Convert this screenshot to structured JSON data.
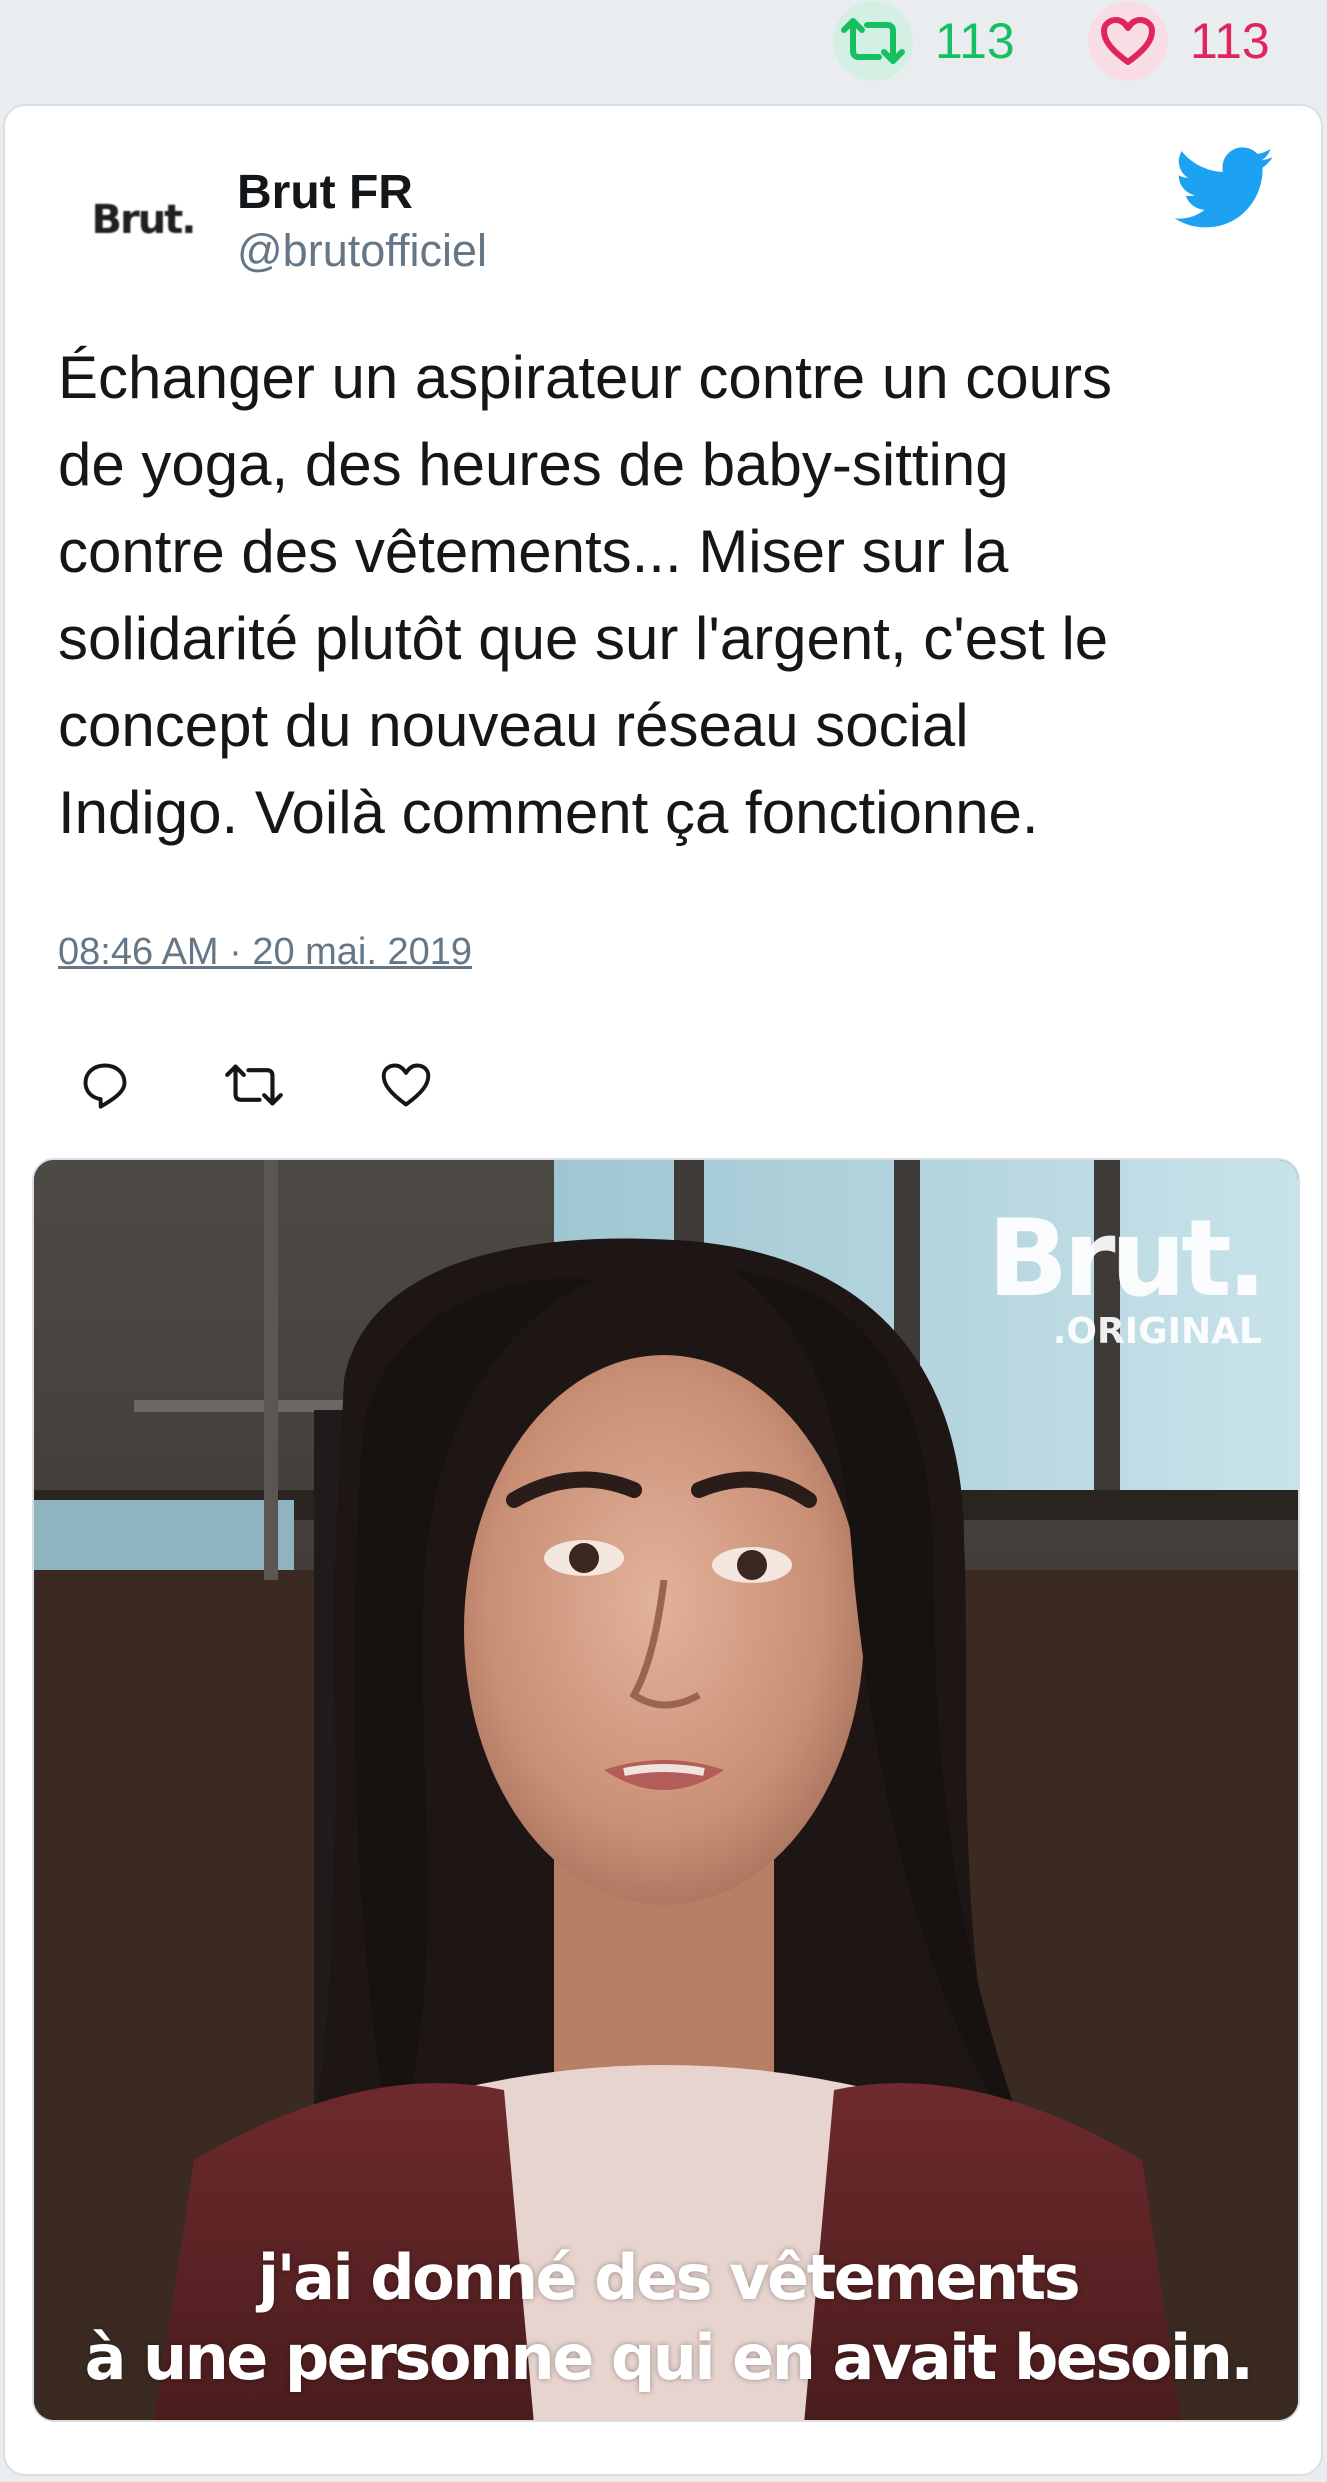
{
  "stats": {
    "retweet_icon": "retweet-icon",
    "retweet_count": "113",
    "like_icon": "heart-icon",
    "like_count": "113"
  },
  "tweet": {
    "avatar_text": "Brut.",
    "user_name": "Brut FR",
    "user_handle": "@brutofficiel",
    "text": "Échanger un aspirateur contre un cours\nde yoga, des heures de baby-sitting\ncontre des vêtements... Miser sur la\nsolidarité plutôt que sur l'argent, c'est le\nconcept du nouveau réseau social\nIndigo. Voilà comment ça fonctionne.",
    "timestamp": "08:46 AM · 20 mai. 2019",
    "actions": [
      "reply-icon",
      "retweet-icon",
      "heart-icon"
    ]
  },
  "media": {
    "watermark_logo": "Brut.",
    "watermark_sub": ".ORIGINAL",
    "subtitle": "j'ai donné des vêtements\nà une personne qui en avait besoin."
  },
  "colors": {
    "background": "#e9edf0",
    "retweet_green": "#17bf63",
    "like_red": "#e0245e",
    "twitter_blue": "#1da1f2",
    "text_primary": "#14171a",
    "text_secondary": "#657786"
  }
}
